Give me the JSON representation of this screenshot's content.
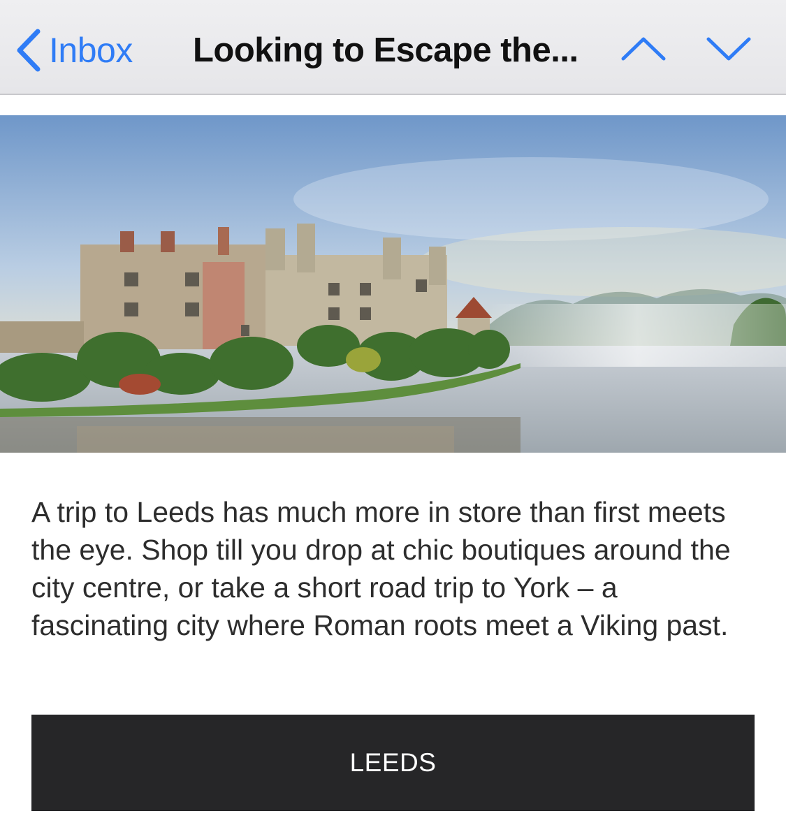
{
  "navbar": {
    "back_label": "Inbox",
    "title": "Looking to Escape the...",
    "accent_color": "#2f7cf6",
    "icons": {
      "back": "chevron-left-icon",
      "previous": "chevron-up-icon",
      "next": "chevron-down-icon"
    }
  },
  "hero": {
    "subject": "castle beside a misty lake"
  },
  "content": {
    "paragraph": "A trip to Leeds has much more in store than first meets the eye. Shop till you drop at chic boutiques around the city centre, or take a short road trip to York – a fascinating city where Roman roots meet a Viking past.",
    "button_label": "LEEDS"
  }
}
